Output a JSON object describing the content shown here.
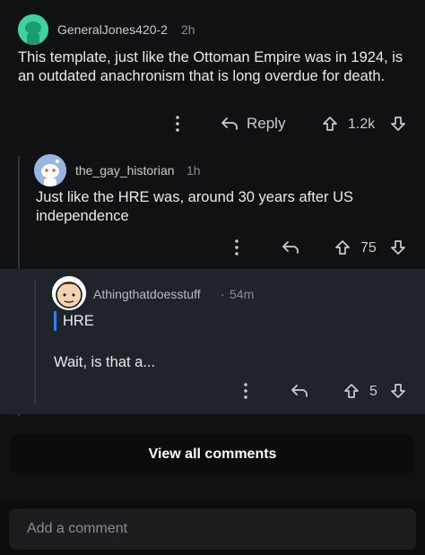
{
  "comments": [
    {
      "username": "GeneralJones420-2",
      "time": "2h",
      "text": "This template, just like the Ottoman Empire was in 1924, is an outdated anachronism that is long overdue for death.",
      "reply_label": "Reply",
      "votes": "1.2k"
    },
    {
      "username": "the_gay_historian",
      "time": "1h",
      "text": "Just like the HRE was, around 30 years after US independence",
      "votes": "75"
    },
    {
      "username": "Athingthatdoesstuff",
      "separator": "·",
      "time": "54m",
      "quote": "HRE",
      "text": "Wait, is that a...",
      "votes": "5"
    }
  ],
  "view_all_label": "View all comments",
  "add_comment_placeholder": "Add a comment",
  "colors": {
    "background": "#101112",
    "highlight": "#1e2429",
    "quote_bar": "#2f80ed"
  },
  "icons": [
    "avatar",
    "more-icon",
    "reply-arrow-icon",
    "upvote-icon",
    "downvote-icon"
  ]
}
